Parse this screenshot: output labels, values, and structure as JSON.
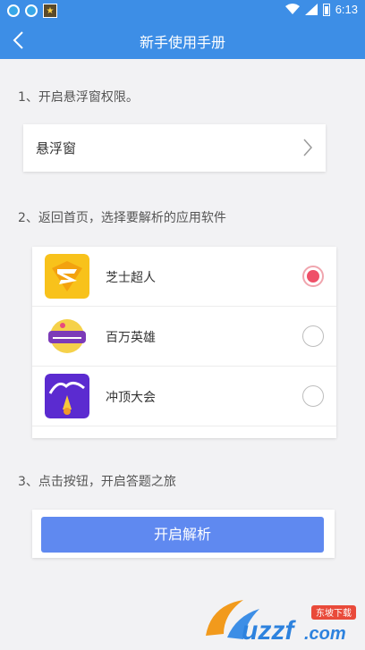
{
  "status": {
    "time": "6:13",
    "battery_level": 0.6
  },
  "header": {
    "title": "新手使用手册"
  },
  "steps": [
    {
      "label": "1、开启悬浮窗权限。"
    },
    {
      "label": "2、返回首页，选择要解析的应用软件"
    },
    {
      "label": "3、点击按钮，开启答题之旅"
    }
  ],
  "permission": {
    "label": "悬浮窗"
  },
  "apps": [
    {
      "name": "芝士超人",
      "selected": true,
      "icon": "zhishi-chaoren-icon"
    },
    {
      "name": "百万英雄",
      "selected": false,
      "icon": "baiwan-yingxiong-icon"
    },
    {
      "name": "冲顶大会",
      "selected": false,
      "icon": "chongding-dahui-icon"
    }
  ],
  "action": {
    "button_label": "开启解析"
  },
  "watermark": {
    "brand": "uzzf.com",
    "tagline": "东坡下载"
  },
  "colors": {
    "primary": "#3d8ee6",
    "button": "#5f89f0",
    "radio_selected": "#ef5068"
  }
}
